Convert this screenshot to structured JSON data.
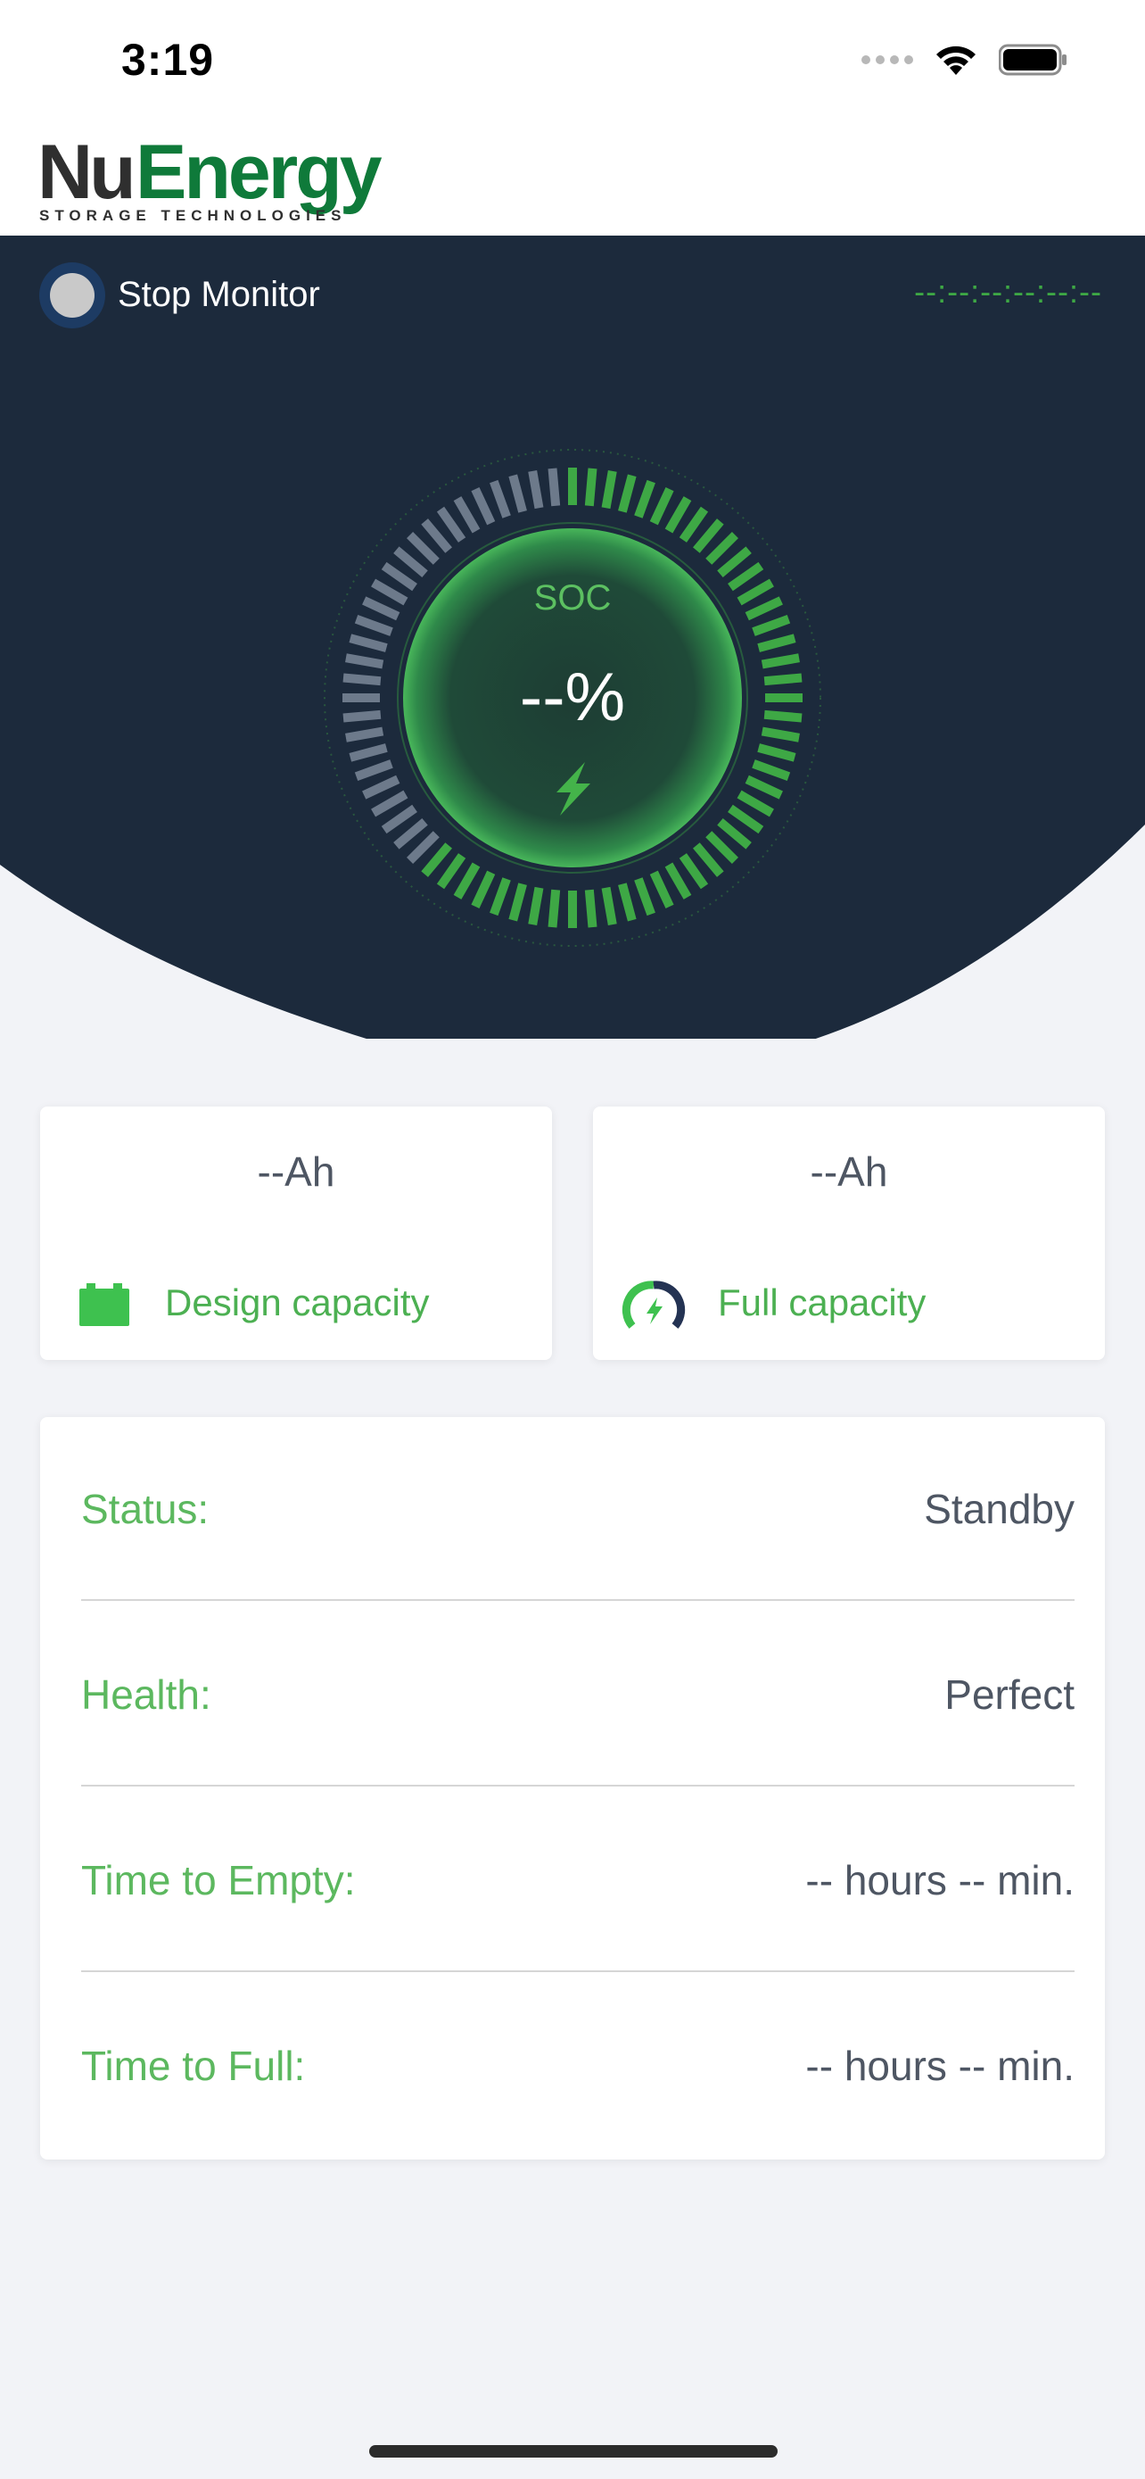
{
  "status_bar": {
    "time": "3:19"
  },
  "brand": {
    "logo_main": "NuEnergy",
    "logo_sub": "STORAGE TECHNOLOGIES"
  },
  "monitor": {
    "toggle_label": "Stop Monitor",
    "timestamp": "--:--:--:--:--:--"
  },
  "gauge": {
    "label": "SOC",
    "value": "--%",
    "filled_fraction": 0.62
  },
  "capacity": {
    "design": {
      "value": "--Ah",
      "label": "Design capacity"
    },
    "full": {
      "value": "--Ah",
      "label": "Full capacity"
    }
  },
  "details": [
    {
      "label": "Status:",
      "value": "Standby"
    },
    {
      "label": "Health:",
      "value": "Perfect"
    },
    {
      "label": "Time to Empty:",
      "value": "-- hours -- min."
    },
    {
      "label": "Time to Full:",
      "value": "-- hours -- min."
    }
  ],
  "colors": {
    "dark_bg": "#1c2a3c",
    "accent_green": "#3ea845",
    "text_gray": "#4e5663",
    "tick_gray": "#6d7a8b"
  },
  "icons": {
    "battery": "battery-icon",
    "gauge": "speedometer-icon",
    "bolt": "lightning-icon",
    "wifi": "wifi-icon",
    "signal": "signal-icon",
    "battery_status": "battery-status-icon"
  }
}
